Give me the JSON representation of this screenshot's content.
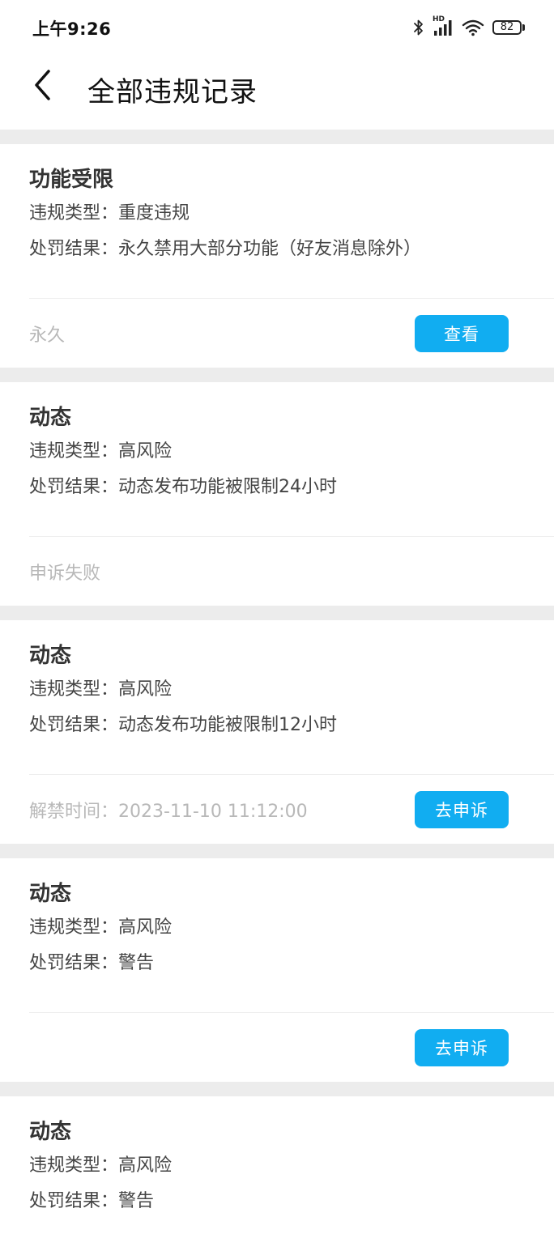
{
  "status_bar": {
    "time": "上午9:26",
    "network_label": "HD",
    "battery": "82"
  },
  "header": {
    "title": "全部违规记录"
  },
  "records": [
    {
      "title": "功能受限",
      "type_label": "违规类型：",
      "type_value": "重度违规",
      "result_label": "处罚结果：",
      "result_value": "永久禁用大部分功能（好友消息除外）",
      "footer_label": "",
      "footer_value": "永久",
      "button_label": "查看"
    },
    {
      "title": "动态",
      "type_label": "违规类型：",
      "type_value": "高风险",
      "result_label": "处罚结果：",
      "result_value": "动态发布功能被限制24小时",
      "footer_label": "",
      "footer_value": "申诉失败",
      "button_label": ""
    },
    {
      "title": "动态",
      "type_label": "违规类型：",
      "type_value": "高风险",
      "result_label": "处罚结果：",
      "result_value": "动态发布功能被限制12小时",
      "footer_label": "解禁时间：",
      "footer_value": "2023-11-10 11:12:00",
      "button_label": "去申诉"
    },
    {
      "title": "动态",
      "type_label": "违规类型：",
      "type_value": "高风险",
      "result_label": "处罚结果：",
      "result_value": "警告",
      "footer_label": "",
      "footer_value": "",
      "button_label": "去申诉"
    },
    {
      "title": "动态",
      "type_label": "违规类型：",
      "type_value": "高风险",
      "result_label": "处罚结果：",
      "result_value": "警告"
    }
  ],
  "colors": {
    "accent": "#11adf1",
    "page_background": "#ececec",
    "muted_text": "#b8b8b8"
  },
  "icons": {
    "back": "chevron-left-icon",
    "bluetooth": "bluetooth-icon",
    "signal": "signal-icon",
    "wifi": "wifi-icon",
    "battery": "battery-icon"
  }
}
